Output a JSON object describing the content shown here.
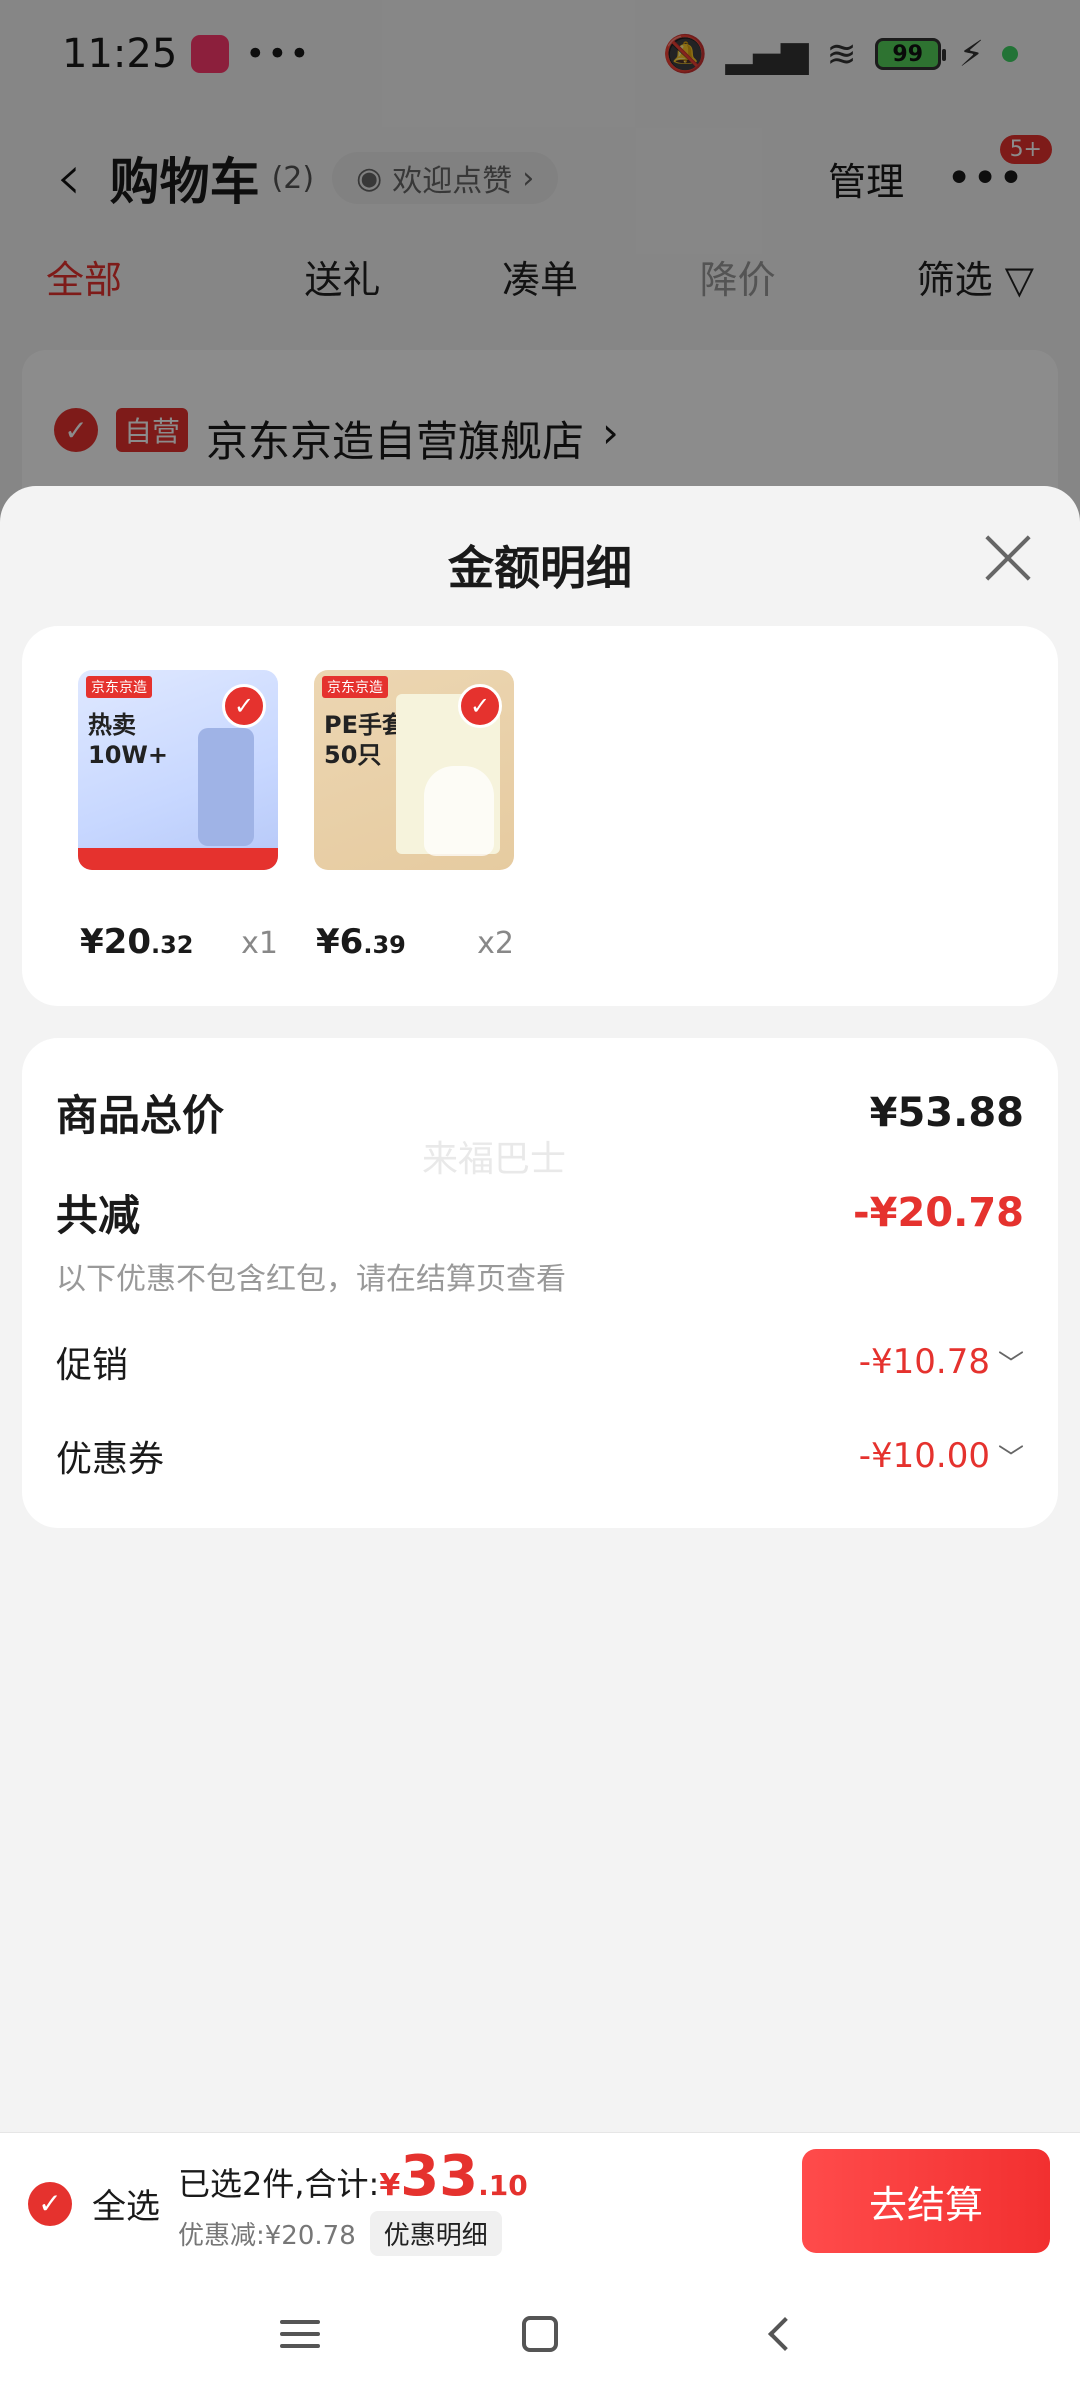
{
  "status_bar": {
    "time": "11:25",
    "more": "•••",
    "battery": "99"
  },
  "header": {
    "title": "购物车",
    "count": "(2)",
    "like_pill": "欢迎点赞",
    "manage": "管理",
    "badge": "5+"
  },
  "tabs": [
    {
      "label": "全部"
    },
    {
      "label": "送礼"
    },
    {
      "label": "凑单"
    },
    {
      "label": "降价"
    },
    {
      "label": "筛选"
    }
  ],
  "store": {
    "tag": "自营",
    "name": "京东京造自营旗舰店"
  },
  "sheet": {
    "title": "金额明细",
    "items": [
      {
        "brand": "京东京造",
        "title_line1": "热卖",
        "title_line2": "10W+",
        "price_main": "¥20",
        "price_dec": ".32",
        "qty": "x1"
      },
      {
        "brand": "京东京造",
        "title_line1": "PE手套",
        "title_line2": "50只",
        "price_main": "¥6",
        "price_dec": ".39",
        "qty": "x2"
      }
    ],
    "watermark": "来福巴士",
    "total_label": "商品总价",
    "total_value": "¥53.88",
    "reduce_label": "共减",
    "reduce_value": "-¥20.78",
    "note": "以下优惠不包含红包，请在结算页查看",
    "promo_label": "促销",
    "promo_value": "-¥10.78",
    "coupon_label": "优惠券",
    "coupon_value": "-¥10.00"
  },
  "bottom_bar": {
    "select_all": "全选",
    "selected_text": "已选2件,合计:",
    "yen": "¥",
    "total_int": "33",
    "total_dec": ".10",
    "discount_text": "优惠减:¥20.78",
    "detail_chip": "优惠明细",
    "checkout": "去结算"
  },
  "icons": {
    "check": "✓",
    "chevron_right": "›",
    "chevron_down": "﹀",
    "back": "‹",
    "filter": "▽",
    "eye": "◉"
  },
  "colors": {
    "accent": "#e5322e",
    "sheet_bg": "#f3f3f3"
  }
}
